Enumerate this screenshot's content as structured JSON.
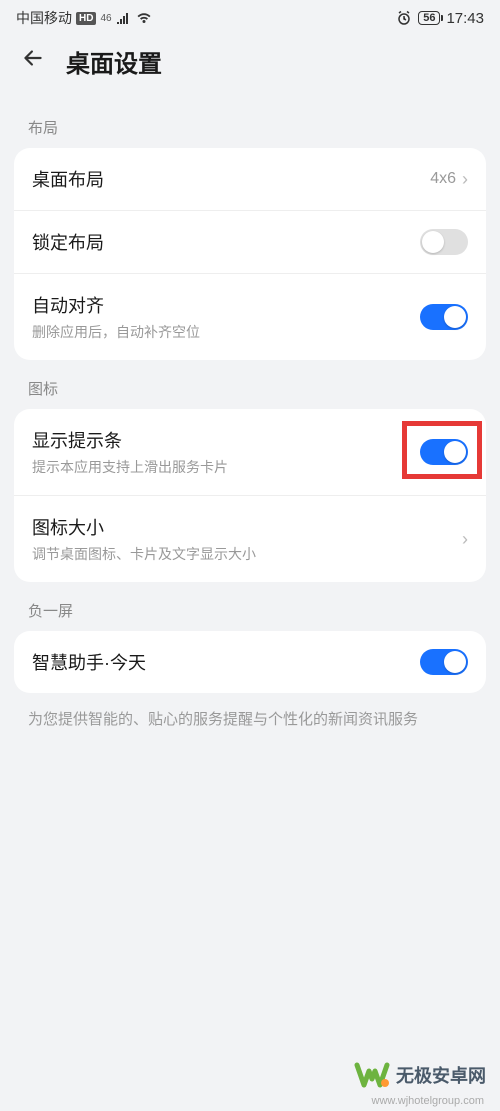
{
  "status_bar": {
    "carrier": "中国移动",
    "hd_badge": "HD",
    "net_badge": "46",
    "battery_text": "56",
    "time": "17:43"
  },
  "header": {
    "title": "桌面设置"
  },
  "sections": {
    "layout": {
      "label": "布局",
      "items": {
        "desktop_layout": {
          "title": "桌面布局",
          "value": "4x6"
        },
        "lock_layout": {
          "title": "锁定布局",
          "toggle": false
        },
        "auto_align": {
          "title": "自动对齐",
          "subtitle": "删除应用后，自动补齐空位",
          "toggle": true
        }
      }
    },
    "icons": {
      "label": "图标",
      "items": {
        "show_hint_bar": {
          "title": "显示提示条",
          "subtitle": "提示本应用支持上滑出服务卡片",
          "toggle": true
        },
        "icon_size": {
          "title": "图标大小",
          "subtitle": "调节桌面图标、卡片及文字显示大小"
        }
      }
    },
    "minus_one": {
      "label": "负一屏",
      "items": {
        "smart_assistant": {
          "title": "智慧助手·今天",
          "toggle": true
        }
      },
      "footer": "为您提供智能的、贴心的服务提醒与个性化的新闻资讯服务"
    }
  },
  "watermark": {
    "text": "无极安卓网",
    "url": "www.wjhotelgroup.com"
  }
}
